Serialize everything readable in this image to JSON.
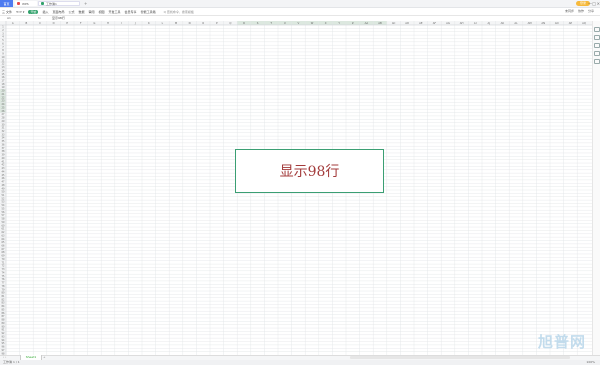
{
  "titlebar": {
    "home_tab": "首页",
    "wps_tab": "WPS",
    "book_tab": "工作簿1",
    "add_tab": "+",
    "login_label": "登录",
    "minimize": "—",
    "maximize": "□",
    "close": "×"
  },
  "ribbon": {
    "file_label": "三 文件",
    "tabs": [
      "开始",
      "插入",
      "页面布局",
      "公式",
      "数据",
      "审阅",
      "视图",
      "开发工具",
      "会员专享",
      "智能工具箱"
    ],
    "active_index": 0,
    "search_label": "Q 查找命令、搜索模板",
    "right_items": [
      "未同步",
      "协作",
      "分享"
    ]
  },
  "formula_bar": {
    "name_box": "A1",
    "fx": "fx",
    "value": "显示98行"
  },
  "columns": [
    "A",
    "B",
    "C",
    "D",
    "E",
    "F",
    "G",
    "H",
    "I",
    "J",
    "K",
    "L",
    "M",
    "N",
    "O",
    "P",
    "Q",
    "R",
    "S",
    "T",
    "U",
    "V",
    "W",
    "X",
    "Y",
    "Z",
    "AA",
    "AB",
    "AC",
    "AD",
    "AE",
    "AF",
    "AG",
    "AH",
    "AI",
    "AJ",
    "AK",
    "AL",
    "AM",
    "AN",
    "AO",
    "AP",
    "AQ"
  ],
  "row_count": 98,
  "selected_rows": [
    20,
    26
  ],
  "selected_cols": [
    17,
    27
  ],
  "popup_text": "显示98行",
  "sheet_tab": "Sheet1",
  "status": {
    "left": "工作簿 1 / 1",
    "zoom": "100%"
  },
  "watermark": "旭普网",
  "colors": {
    "accent": "#31a16b",
    "popup_border": "#3b9f73",
    "popup_text": "#a33b3b",
    "selection": "#dce8df"
  }
}
